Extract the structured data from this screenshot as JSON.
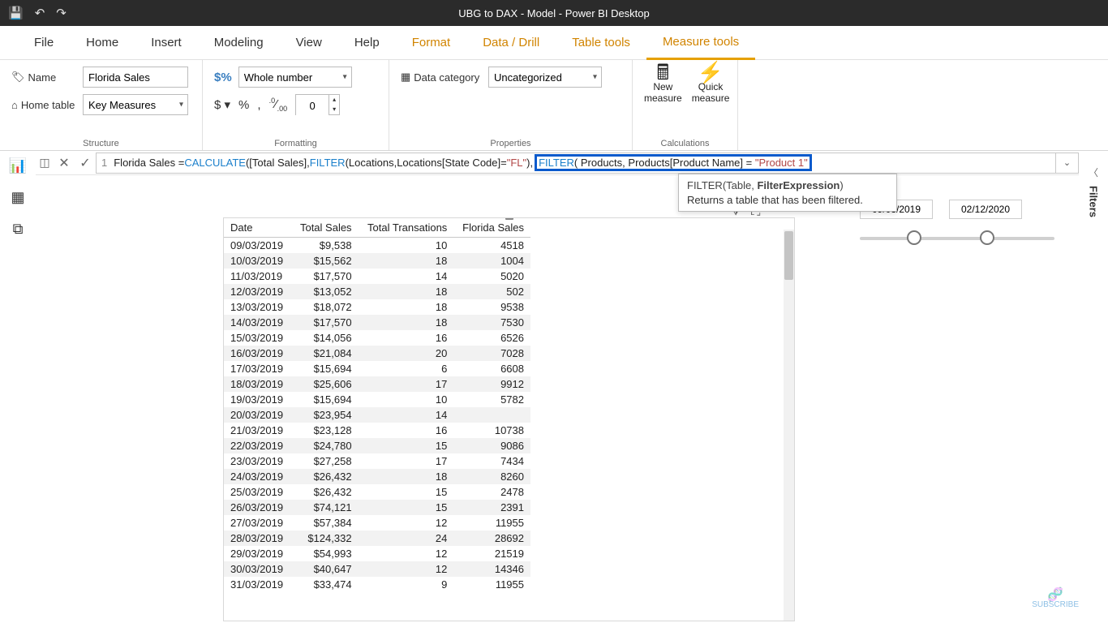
{
  "titlebar": {
    "title": "UBG to DAX - Model - Power BI Desktop"
  },
  "ribbon_tabs": [
    "File",
    "Home",
    "Insert",
    "Modeling",
    "View",
    "Help",
    "Format",
    "Data / Drill",
    "Table tools",
    "Measure tools"
  ],
  "ribbon": {
    "structure": {
      "name_label": "Name",
      "name_value": "Florida Sales",
      "hometable_label": "Home table",
      "hometable_value": "Key Measures",
      "group_label": "Structure"
    },
    "formatting": {
      "format_value": "Whole number",
      "decimals": "0",
      "group_label": "Formatting"
    },
    "properties": {
      "datacat_label": "Data category",
      "datacat_value": "Uncategorized",
      "group_label": "Properties"
    },
    "calculations": {
      "new": "New measure",
      "quick": "Quick measure",
      "group_label": "Calculations"
    }
  },
  "formula": {
    "line_no": "1",
    "measure_name": "Florida Sales",
    "func_calculate": "CALCULATE",
    "total_sales": "[Total Sales]",
    "func_filter": "FILTER",
    "locations_tbl": "Locations",
    "state_col": "Locations[State Code]",
    "fl_str": "\"FL\"",
    "products_tbl": "Products",
    "product_col": "Products[Product Name]",
    "prod1_str": "\"Product 1\""
  },
  "tooltip": {
    "sig_pre": "FILTER(Table, ",
    "sig_bold": "FilterExpression",
    "sig_post": ")",
    "description": "Returns a table that has been filtered."
  },
  "slicer": {
    "start": "09/03/2019",
    "end": "02/12/2020"
  },
  "filters_label": "Filters",
  "table": {
    "headers": [
      "Date",
      "Total Sales",
      "Total Transations",
      "Florida Sales"
    ],
    "rows": [
      [
        "09/03/2019",
        "$9,538",
        "10",
        "4518"
      ],
      [
        "10/03/2019",
        "$15,562",
        "18",
        "1004"
      ],
      [
        "11/03/2019",
        "$17,570",
        "14",
        "5020"
      ],
      [
        "12/03/2019",
        "$13,052",
        "18",
        "502"
      ],
      [
        "13/03/2019",
        "$18,072",
        "18",
        "9538"
      ],
      [
        "14/03/2019",
        "$17,570",
        "18",
        "7530"
      ],
      [
        "15/03/2019",
        "$14,056",
        "16",
        "6526"
      ],
      [
        "16/03/2019",
        "$21,084",
        "20",
        "7028"
      ],
      [
        "17/03/2019",
        "$15,694",
        "6",
        "6608"
      ],
      [
        "18/03/2019",
        "$25,606",
        "17",
        "9912"
      ],
      [
        "19/03/2019",
        "$15,694",
        "10",
        "5782"
      ],
      [
        "20/03/2019",
        "$23,954",
        "14",
        ""
      ],
      [
        "21/03/2019",
        "$23,128",
        "16",
        "10738"
      ],
      [
        "22/03/2019",
        "$24,780",
        "15",
        "9086"
      ],
      [
        "23/03/2019",
        "$27,258",
        "17",
        "7434"
      ],
      [
        "24/03/2019",
        "$26,432",
        "18",
        "8260"
      ],
      [
        "25/03/2019",
        "$26,432",
        "15",
        "2478"
      ],
      [
        "26/03/2019",
        "$74,121",
        "15",
        "2391"
      ],
      [
        "27/03/2019",
        "$57,384",
        "12",
        "11955"
      ],
      [
        "28/03/2019",
        "$124,332",
        "24",
        "28692"
      ],
      [
        "29/03/2019",
        "$54,993",
        "12",
        "21519"
      ],
      [
        "30/03/2019",
        "$40,647",
        "12",
        "14346"
      ],
      [
        "31/03/2019",
        "$33,474",
        "9",
        "11955"
      ]
    ]
  },
  "watermark": "SUBSCRIBE"
}
